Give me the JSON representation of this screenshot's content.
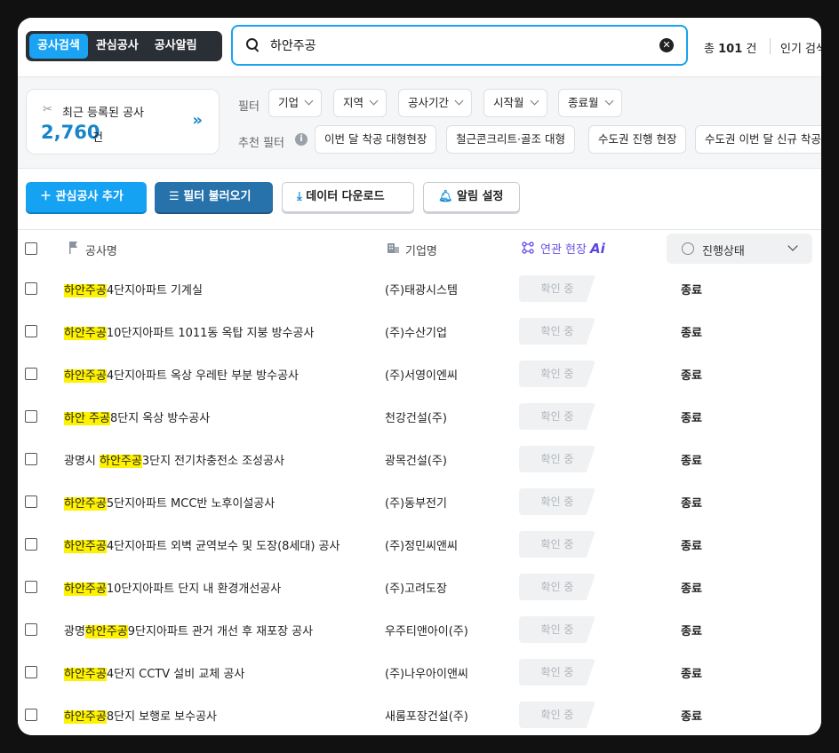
{
  "top": {
    "tabs": [
      "공사검색",
      "관심공사",
      "공사알림"
    ],
    "active_tab": 0,
    "search_value": "하안주공",
    "total_prefix": "총",
    "total_count": "101",
    "total_unit": "건",
    "popular_label": "인기 검색"
  },
  "recent": {
    "title": "최근 등록된 공사",
    "count": "2,760",
    "unit": "건"
  },
  "filters": {
    "label": "필터",
    "items": [
      "기업",
      "지역",
      "공사기간",
      "시작월",
      "종료월"
    ],
    "recommend_label": "추천 필터",
    "recommend_items": [
      "이번 달 착공 대형현장",
      "철근콘크리트·골조 대형",
      "수도권 진행 현장",
      "수도권 이번 달 신규 착공"
    ]
  },
  "actions": {
    "add": "관심공사 추가",
    "load_filter": "필터 불러오기",
    "download": "데이터 다운로드",
    "alert": "알림 설정"
  },
  "table": {
    "headers": {
      "name": "공사명",
      "company": "기업명",
      "related": "연관 현장",
      "related_badge": "Ai",
      "status": "진행상태"
    },
    "rows": [
      {
        "pre": "",
        "hl": "하안주공",
        "post": "4단지아파트 기계실",
        "company": "(주)태광시스템",
        "related": "확인 중",
        "status": "종료"
      },
      {
        "pre": "",
        "hl": "하안주공",
        "post": "10단지아파트 1011동 옥탑 지붕 방수공사",
        "company": "(주)수산기업",
        "related": "확인 중",
        "status": "종료"
      },
      {
        "pre": "",
        "hl": "하안주공",
        "post": "4단지아파트 옥상 우레탄 부분 방수공사",
        "company": "(주)서영이엔씨",
        "related": "확인 중",
        "status": "종료"
      },
      {
        "pre": "",
        "hl": "하안 주공",
        "post": "8단지 옥상 방수공사",
        "company": "천강건설(주)",
        "related": "확인 중",
        "status": "종료"
      },
      {
        "pre": "광명시 ",
        "hl": "하안주공",
        "post": "3단지 전기차충전소 조성공사",
        "company": "광목건설(주)",
        "related": "확인 중",
        "status": "종료"
      },
      {
        "pre": "",
        "hl": "하안주공",
        "post": "5단지아파트 MCC반 노후이설공사",
        "company": "(주)동부전기",
        "related": "확인 중",
        "status": "종료"
      },
      {
        "pre": "",
        "hl": "하안주공",
        "post": "4단지아파트 외벽 균역보수 및 도장(8세대) 공사",
        "company": "(주)정민씨앤씨",
        "related": "확인 중",
        "status": "종료"
      },
      {
        "pre": "",
        "hl": "하안주공",
        "post": "10단지아파트 단지 내 환경개선공사",
        "company": "(주)고려도장",
        "related": "확인 중",
        "status": "종료"
      },
      {
        "pre": "광명",
        "hl": "하안주공",
        "post": "9단지아파트 관거 개선 후 재포장 공사",
        "company": "우주티앤아이(주)",
        "related": "확인 중",
        "status": "종료"
      },
      {
        "pre": "",
        "hl": "하안주공",
        "post": "4단지 CCTV 설비 교체 공사",
        "company": "(주)나우아이앤씨",
        "related": "확인 중",
        "status": "종료"
      },
      {
        "pre": "",
        "hl": "하안주공",
        "post": "8단지 보행로 보수공사",
        "company": "새롬포장건설(주)",
        "related": "확인 중",
        "status": "종료"
      }
    ]
  }
}
